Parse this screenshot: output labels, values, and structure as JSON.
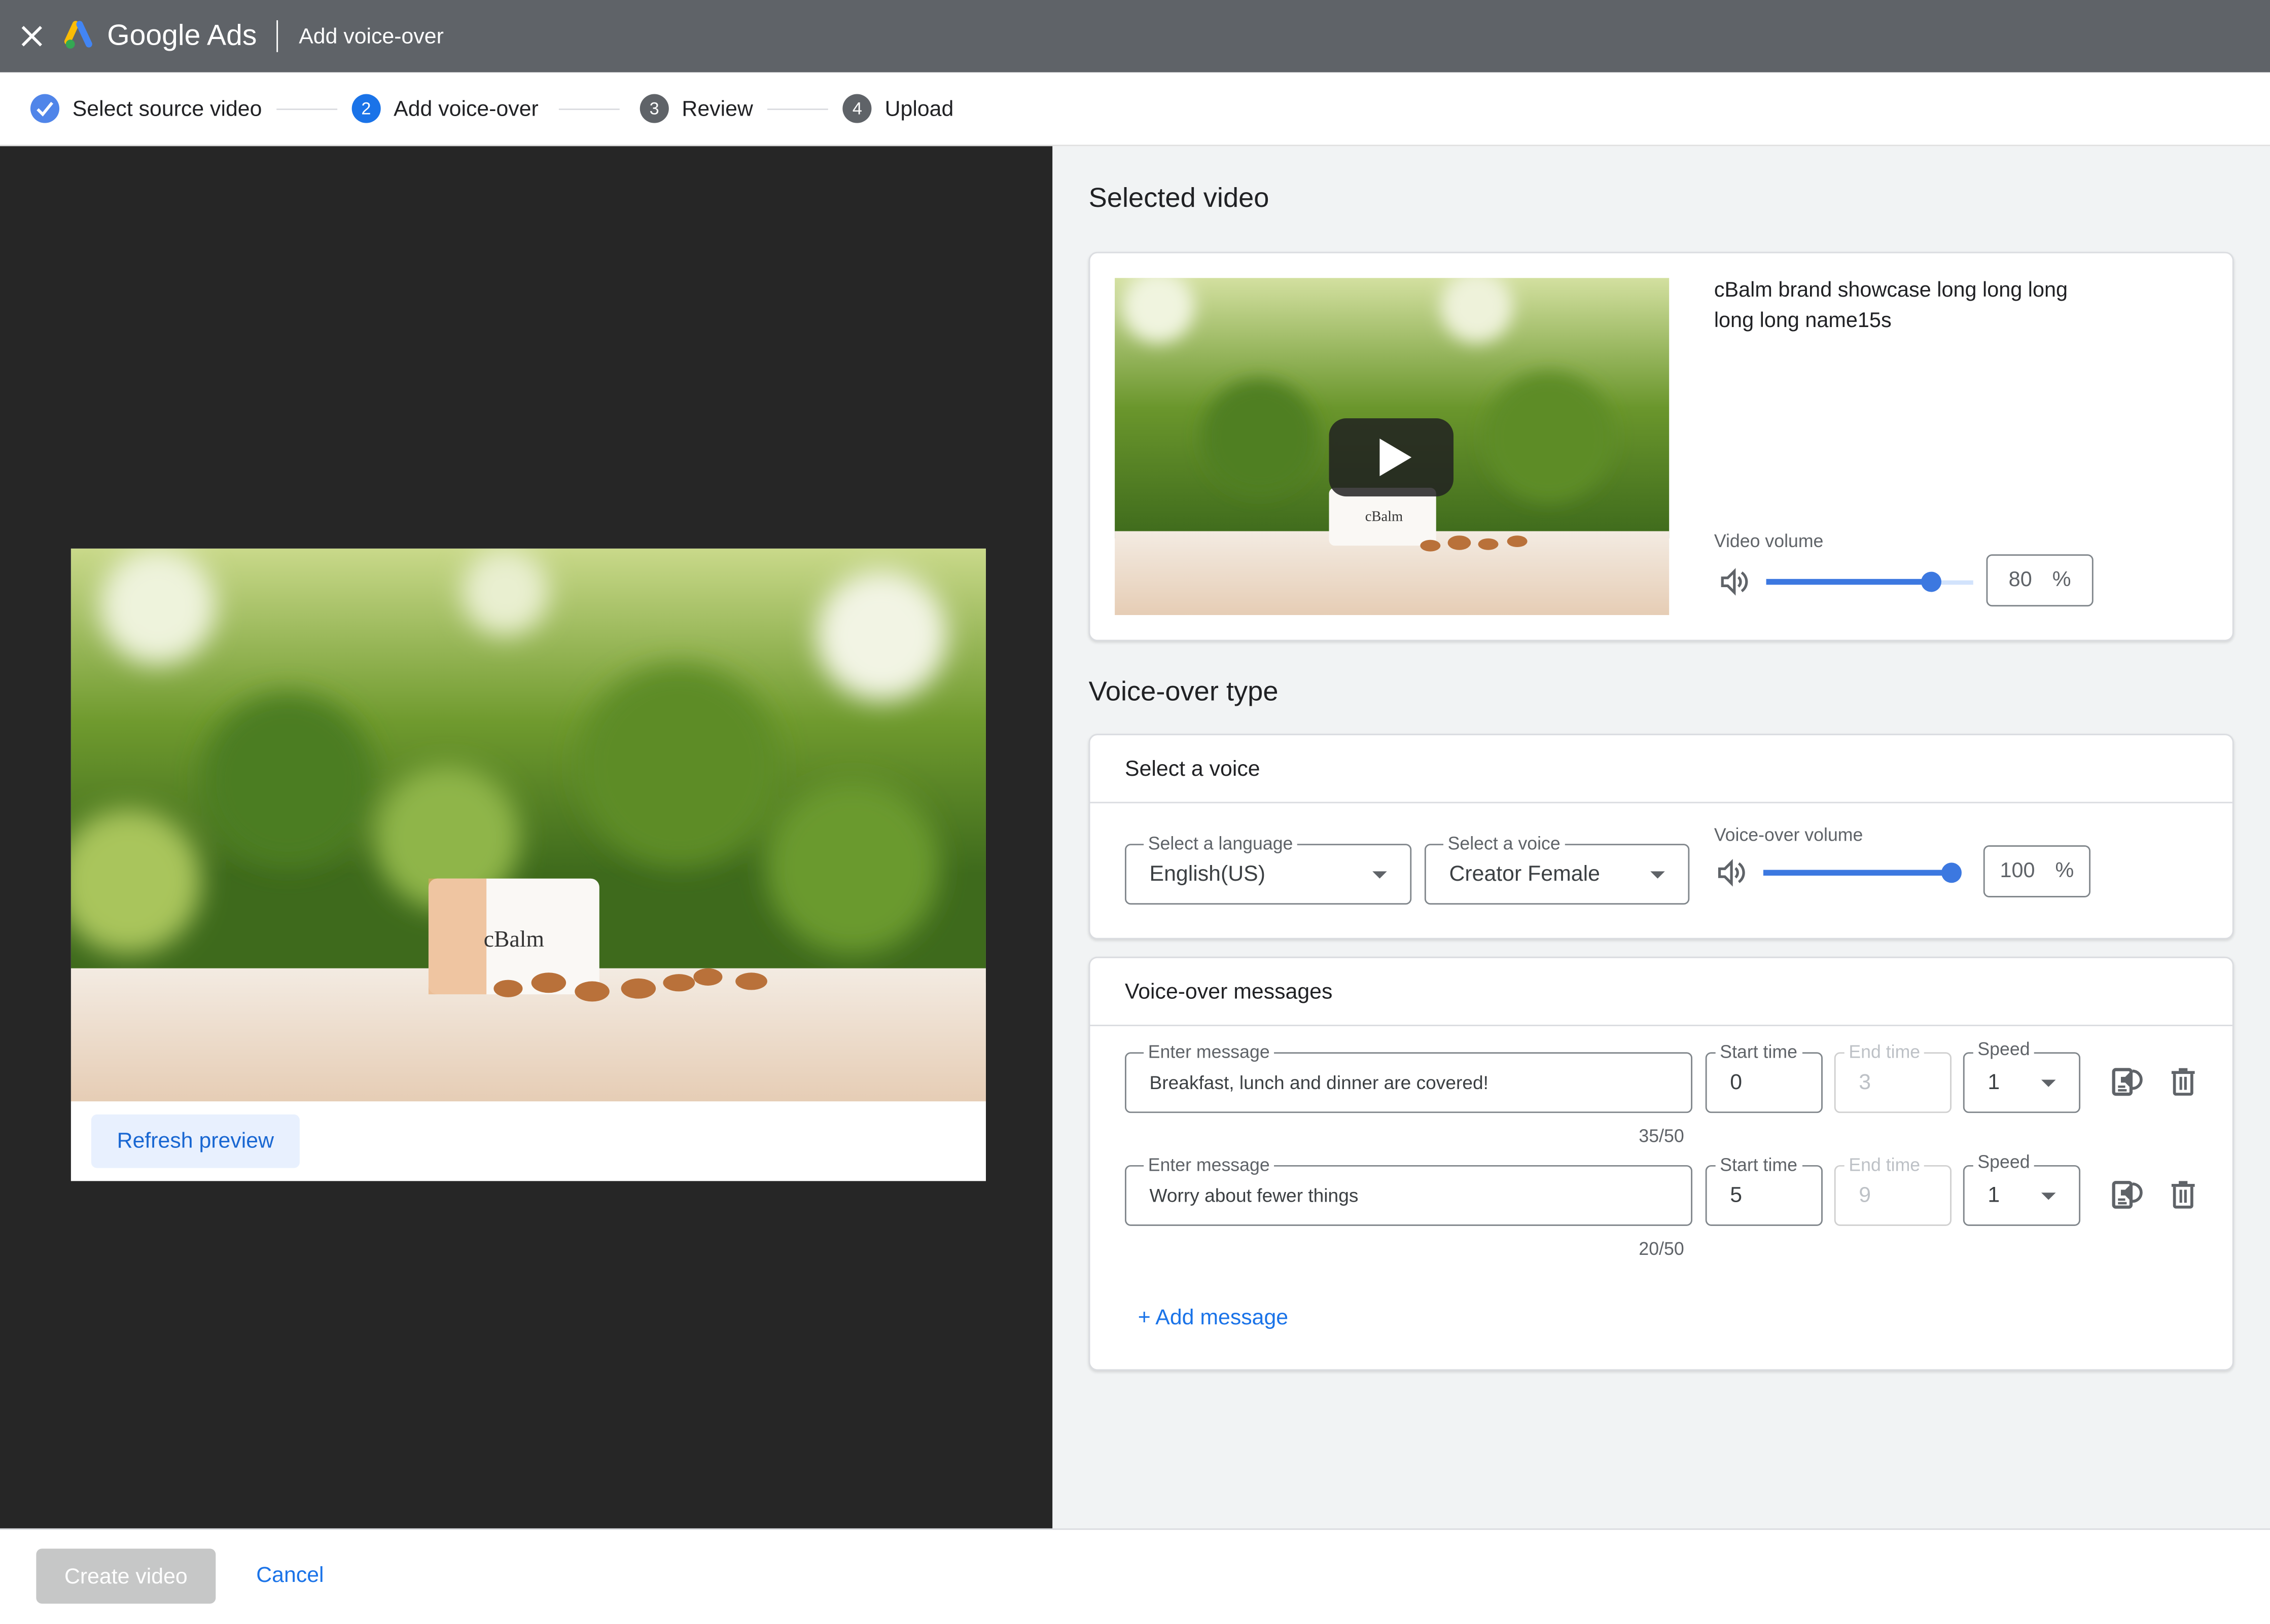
{
  "header": {
    "brand": "Google Ads",
    "title": "Add voice-over",
    "colors": {
      "bar": "#5f6368",
      "accent": "#1a73e8"
    }
  },
  "stepper": {
    "steps": [
      {
        "label": "Select source video",
        "marker": "",
        "state": "done"
      },
      {
        "label": "Add voice-over",
        "marker": "2",
        "state": "active"
      },
      {
        "label": "Review",
        "marker": "3",
        "state": "todo"
      },
      {
        "label": "Upload",
        "marker": "4",
        "state": "todo"
      }
    ]
  },
  "preview": {
    "refresh_label": "Refresh preview",
    "image_description": "cBalm almond facial moisturizer jar with almonds in front of green foliage"
  },
  "selected_video": {
    "section_title": "Selected video",
    "name": "cBalm brand showcase long long long long long name15s",
    "volume_label": "Video volume",
    "volume_value": "80",
    "volume_fraction": 0.8,
    "percent_sign": "%"
  },
  "voiceover_type": {
    "section_title": "Voice-over type",
    "card_title": "Select a voice",
    "language_label": "Select a language",
    "language_value": "English(US)",
    "voice_label": "Select a voice",
    "voice_value": "Creator Female",
    "volume_label": "Voice-over volume",
    "volume_value": "100",
    "volume_fraction": 1.0,
    "percent_sign": "%"
  },
  "messages": {
    "card_title": "Voice-over messages",
    "message_label": "Enter message",
    "start_label": "Start time",
    "end_label": "End time",
    "speed_label": "Speed",
    "rows": [
      {
        "text": "Breakfast, lunch and dinner are covered!",
        "start": "0",
        "end": "3",
        "speed": "1",
        "counter": "35/50"
      },
      {
        "text": "Worry about fewer things",
        "start": "5",
        "end": "9",
        "speed": "1",
        "counter": "20/50"
      }
    ],
    "add_label": "+ Add message"
  },
  "footer": {
    "create_label": "Create video",
    "cancel_label": "Cancel"
  }
}
